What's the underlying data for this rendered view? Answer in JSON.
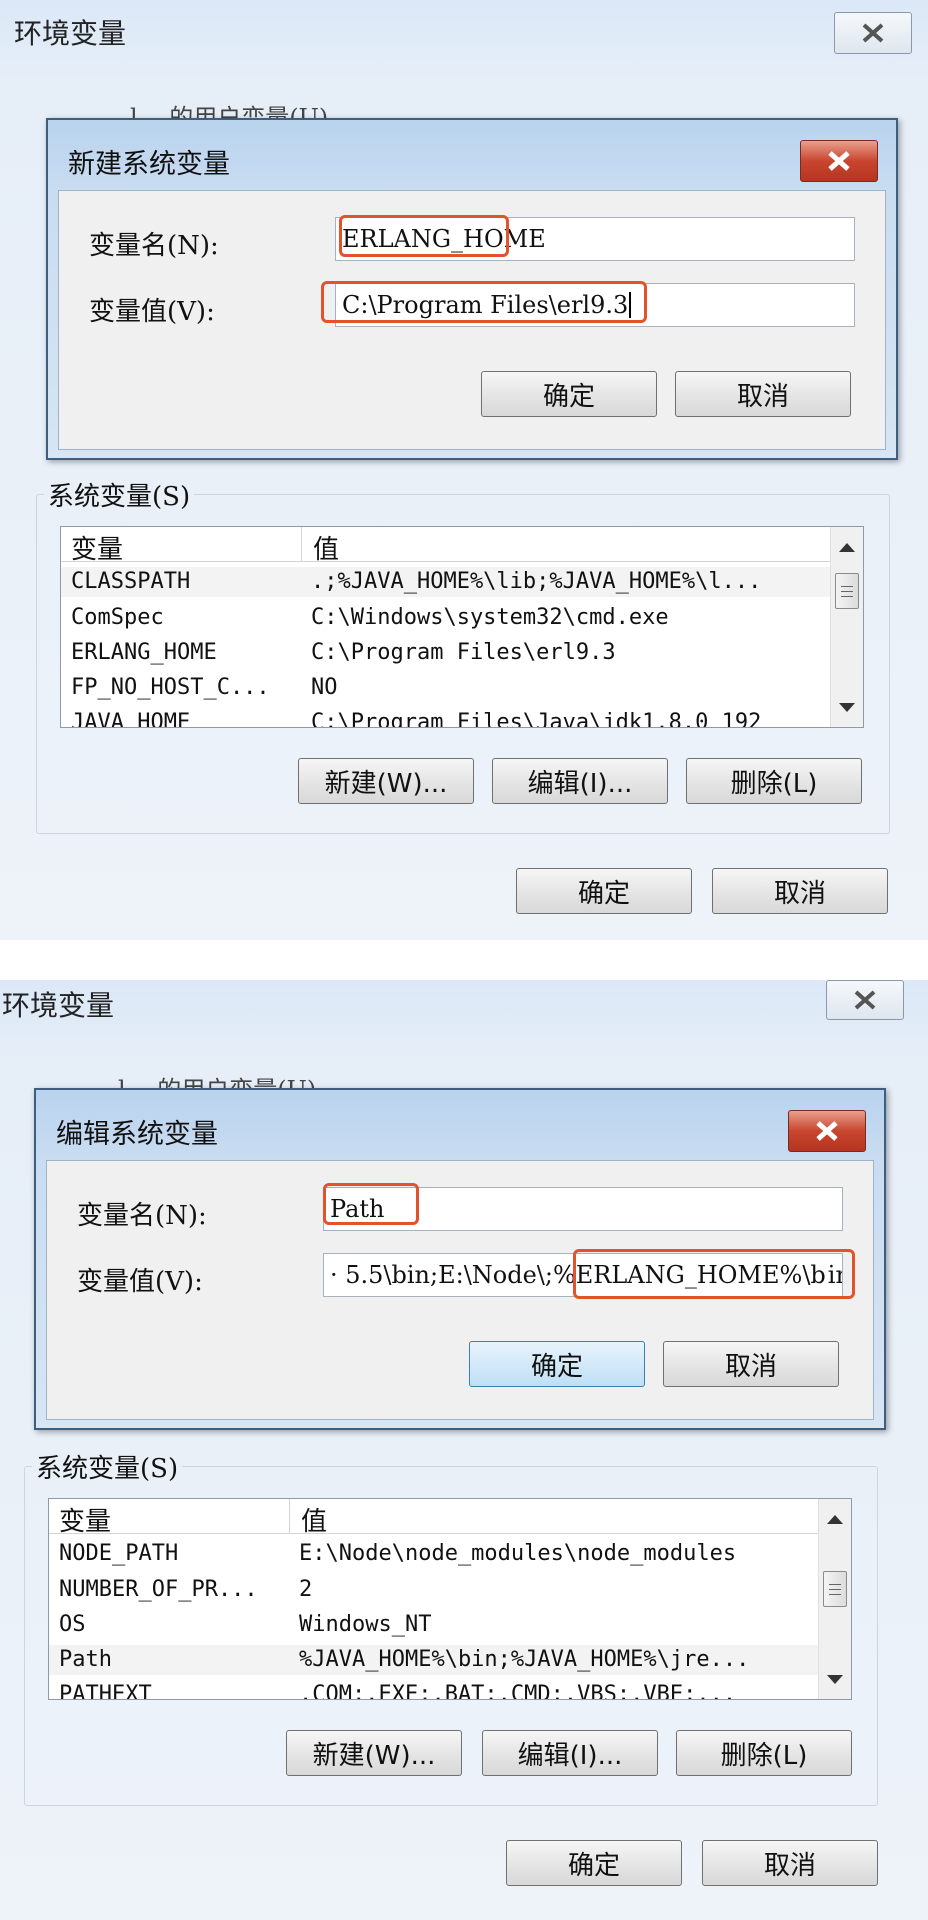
{
  "shot1": {
    "window_title": "环境变量",
    "hidden_label": "l… 的用户变量(U)",
    "dialog": {
      "title": "新建系统变量",
      "name_label": "变量名(N):",
      "name_value": "ERLANG_HOME",
      "value_label": "变量值(V):",
      "value_value": "C:\\Program Files\\erl9.3",
      "ok": "确定",
      "cancel": "取消"
    },
    "sys_label": "系统变量(S)",
    "col_var": "变量",
    "col_val": "值",
    "rows": [
      {
        "name": "CLASSPATH",
        "value": ".;%JAVA_HOME%\\lib;%JAVA_HOME%\\l..."
      },
      {
        "name": "ComSpec",
        "value": "C:\\Windows\\system32\\cmd.exe"
      },
      {
        "name": "ERLANG_HOME",
        "value": "C:\\Program Files\\erl9.3"
      },
      {
        "name": "FP_NO_HOST_C...",
        "value": "NO"
      },
      {
        "name": "JAVA_HOME",
        "value": "C:\\Program Files\\Java\\jdk1.8.0_192"
      }
    ],
    "new_btn": "新建(W)...",
    "edit_btn": "编辑(I)...",
    "delete_btn": "删除(L)",
    "ok": "确定",
    "cancel": "取消"
  },
  "shot2": {
    "window_title": "环境变量",
    "hidden_label": "l… 的用户变量(U)",
    "dialog": {
      "title": "编辑系统变量",
      "name_label": "变量名(N):",
      "name_value": "Path",
      "value_label": "变量值(V):",
      "value_prefix": "· 5.5\\bin;E:\\Node\\",
      "value_highlight": ";%ERLANG_HOME%\\b",
      "value_suffix": "in",
      "ok": "确定",
      "cancel": "取消"
    },
    "sys_label": "系统变量(S)",
    "col_var": "变量",
    "col_val": "值",
    "rows": [
      {
        "name": "NODE_PATH",
        "value": "E:\\Node\\node_modules\\node_modules"
      },
      {
        "name": "NUMBER_OF_PR...",
        "value": "2"
      },
      {
        "name": "OS",
        "value": "Windows_NT"
      },
      {
        "name": "Path",
        "value": "%JAVA_HOME%\\bin;%JAVA_HOME%\\jre..."
      },
      {
        "name": "PATHEXT",
        "value": ".COM;.EXE;.BAT;.CMD;.VBS;.VBE;..."
      }
    ],
    "new_btn": "新建(W)...",
    "edit_btn": "编辑(I)...",
    "delete_btn": "删除(L)",
    "ok": "确定",
    "cancel": "取消"
  },
  "colors": {
    "highlight": "#e2532b",
    "close_red": "#c9462f",
    "title_blue": "#c9dcf1"
  },
  "icons": {
    "close": "close-icon",
    "scroll_up": "scroll-up-arrow-icon",
    "scroll_down": "scroll-down-arrow-icon"
  }
}
